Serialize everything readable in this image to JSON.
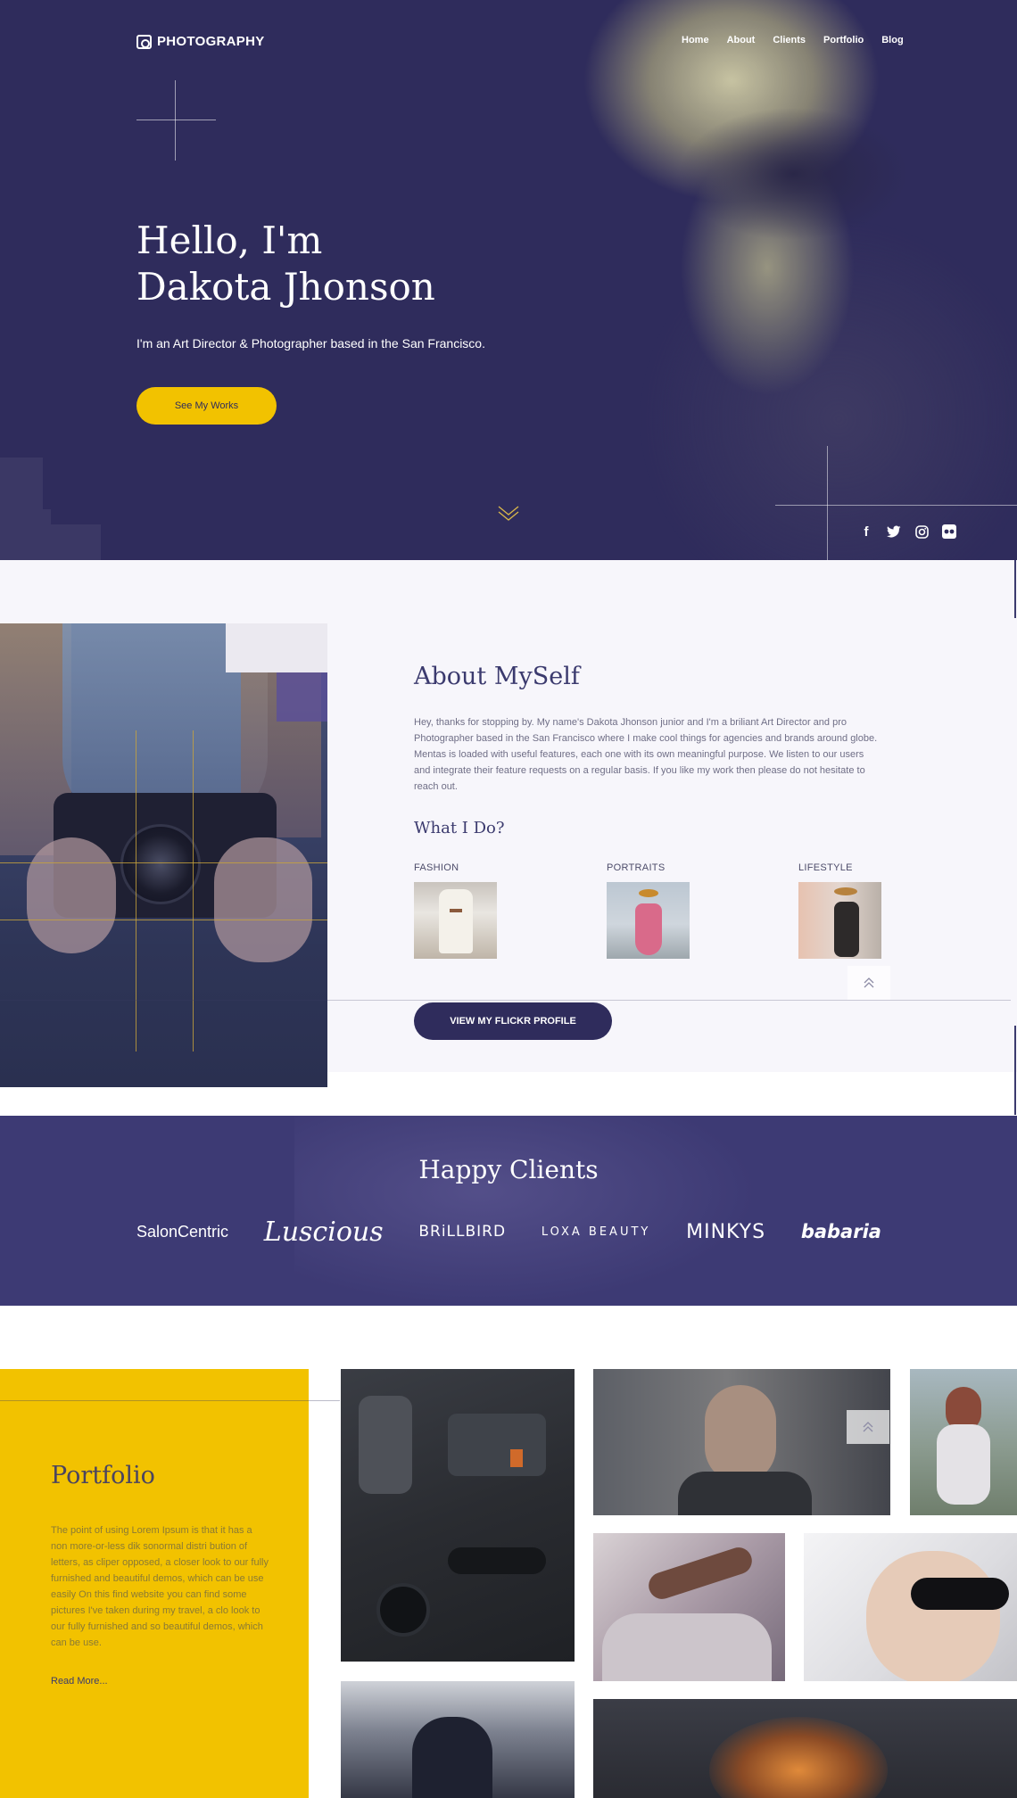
{
  "brand": {
    "name": "PHOTOGRAPHY"
  },
  "nav": {
    "items": [
      "Home",
      "About",
      "Clients",
      "Portfolio",
      "Blog"
    ]
  },
  "hero": {
    "title_line1": "Hello, I'm",
    "title_line2": "Dakota Jhonson",
    "subtitle": "I'm an Art Director & Photographer based in the San Francisco.",
    "cta_label": "See My Works",
    "socials": [
      "facebook-icon",
      "twitter-icon",
      "instagram-icon",
      "flickr-icon"
    ]
  },
  "about": {
    "title": "About MySelf",
    "text": "Hey, thanks for stopping by. My name's Dakota Jhonson junior and I'm a briliant Art Director and pro Photographer based in the San Francisco where I make cool things for agencies and brands around globe. Mentas is loaded with useful features, each one with its own meaningful purpose. We listen to our users and integrate their feature requests on a regular basis. If you like my work then please do not hesitate to reach out.",
    "subtitle": "What I Do?",
    "skills": [
      {
        "label": "FASHION"
      },
      {
        "label": "PORTRAITS"
      },
      {
        "label": "LIFESTYLE"
      }
    ],
    "flickr_label": "VIEW MY FLICKR PROFILE"
  },
  "clients": {
    "title": "Happy Clients",
    "logos": [
      "SalonCentric",
      "Luscious",
      "BRiLLBIRD",
      "LOXA BEAUTY",
      "MINKYS",
      "babaria"
    ]
  },
  "portfolio": {
    "title": "Portfolio",
    "text": "The point of using Lorem Ipsum is that it has a non more-or-less dik sonormal distri bution of letters, as cliper opposed, a closer look to our fully furnished and beautiful demos, which can be use easily On this find website you can find some pictures I've taken during my travel, a clo look to our fully furnished and so beautiful demos, which can be use.",
    "read_more": "Read More..."
  },
  "colors": {
    "navy": "#2f2c5c",
    "yellow": "#f2c200",
    "light_bg": "#f7f6fb",
    "clients_bg": "#3d3a74"
  }
}
